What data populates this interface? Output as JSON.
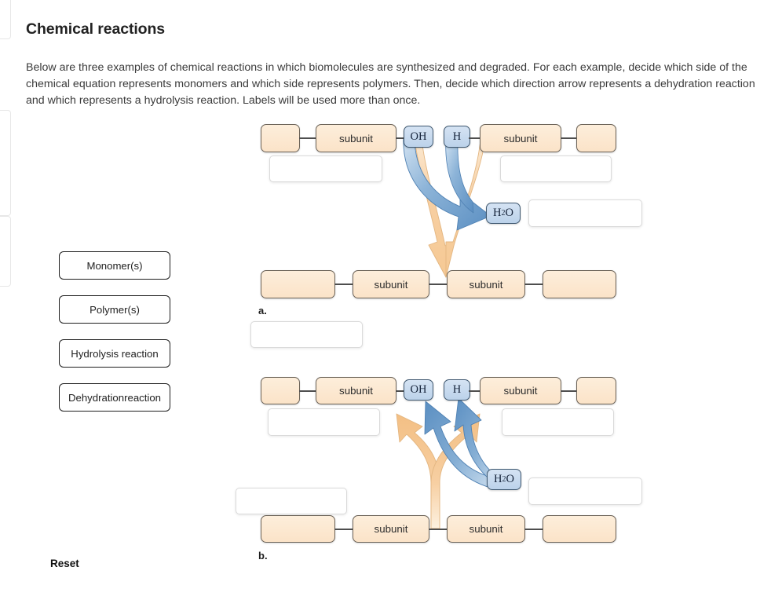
{
  "header": {
    "title": "Chemical reactions",
    "instructions": "Below are three examples of chemical reactions in which biomolecules are synthesized and degraded. For each example, decide which side of the chemical equation represents monomers and which side represents polymers. Then, decide which direction arrow represents a dehydration reaction and which represents a hydrolysis reaction. Labels will be used more than once."
  },
  "label_bank": {
    "items": [
      {
        "label": "Monomer(s)"
      },
      {
        "label": "Polymer(s)"
      },
      {
        "label": "Hydrolysis reaction"
      },
      {
        "label": "Dehydration\nreaction"
      }
    ],
    "item0": "Monomer(s)",
    "item1": "Polymer(s)",
    "item2": "Hydrolysis reaction",
    "item3_line1": "Dehydration",
    "item3_line2": "reaction"
  },
  "reset": {
    "label": "Reset"
  },
  "glyphs": {
    "subunit": "subunit",
    "oh": "OH",
    "h": "H",
    "water_h": "H",
    "water_sub": "2",
    "water_o": "O"
  },
  "diagram_a": {
    "letter": "a.",
    "reactant_row": [
      {
        "text": "",
        "type": "blank"
      },
      {
        "text": "subunit",
        "type": "subunit"
      },
      {
        "text": "OH",
        "type": "atom"
      },
      {
        "text": "H",
        "type": "atom"
      },
      {
        "text": "subunit",
        "type": "subunit"
      },
      {
        "text": "",
        "type": "blank"
      }
    ],
    "product_row": [
      {
        "text": "",
        "type": "blank"
      },
      {
        "text": "subunit",
        "type": "subunit"
      },
      {
        "text": "subunit",
        "type": "subunit"
      },
      {
        "text": "",
        "type": "blank"
      }
    ],
    "water": "H2O",
    "drop_zones": [
      {
        "id": "a-reactant-left",
        "value": ""
      },
      {
        "id": "a-reactant-right",
        "value": ""
      },
      {
        "id": "a-water",
        "value": ""
      },
      {
        "id": "a-arrow",
        "value": ""
      }
    ],
    "arrow_direction": "downward",
    "arrow_colors": {
      "polymer": "#f6cfa0",
      "water": "#6f9fcc"
    }
  },
  "diagram_b": {
    "letter": "b.",
    "reactant_row": [
      {
        "text": "",
        "type": "blank"
      },
      {
        "text": "subunit",
        "type": "subunit"
      },
      {
        "text": "OH",
        "type": "atom"
      },
      {
        "text": "H",
        "type": "atom"
      },
      {
        "text": "subunit",
        "type": "subunit"
      },
      {
        "text": "",
        "type": "blank"
      }
    ],
    "product_row": [
      {
        "text": "",
        "type": "blank"
      },
      {
        "text": "subunit",
        "type": "subunit"
      },
      {
        "text": "subunit",
        "type": "subunit"
      },
      {
        "text": "",
        "type": "blank"
      }
    ],
    "water": "H2O",
    "drop_zones": [
      {
        "id": "b-top-left",
        "value": ""
      },
      {
        "id": "b-top-right",
        "value": ""
      },
      {
        "id": "b-water",
        "value": ""
      },
      {
        "id": "b-bottom-left",
        "value": ""
      }
    ],
    "arrow_direction": "upward",
    "arrow_colors": {
      "polymer": "#f6cfa0",
      "water": "#6f9fcc"
    }
  },
  "colors": {
    "subunit_fill": "#fbe3c8",
    "subunit_border": "#6b6257",
    "atom_fill": "#bcd2ea",
    "atom_border": "#3f5870",
    "arrow_peach": "#f6cfa0",
    "arrow_blue": "#6f9fcc",
    "text": "#3b3b3b"
  }
}
